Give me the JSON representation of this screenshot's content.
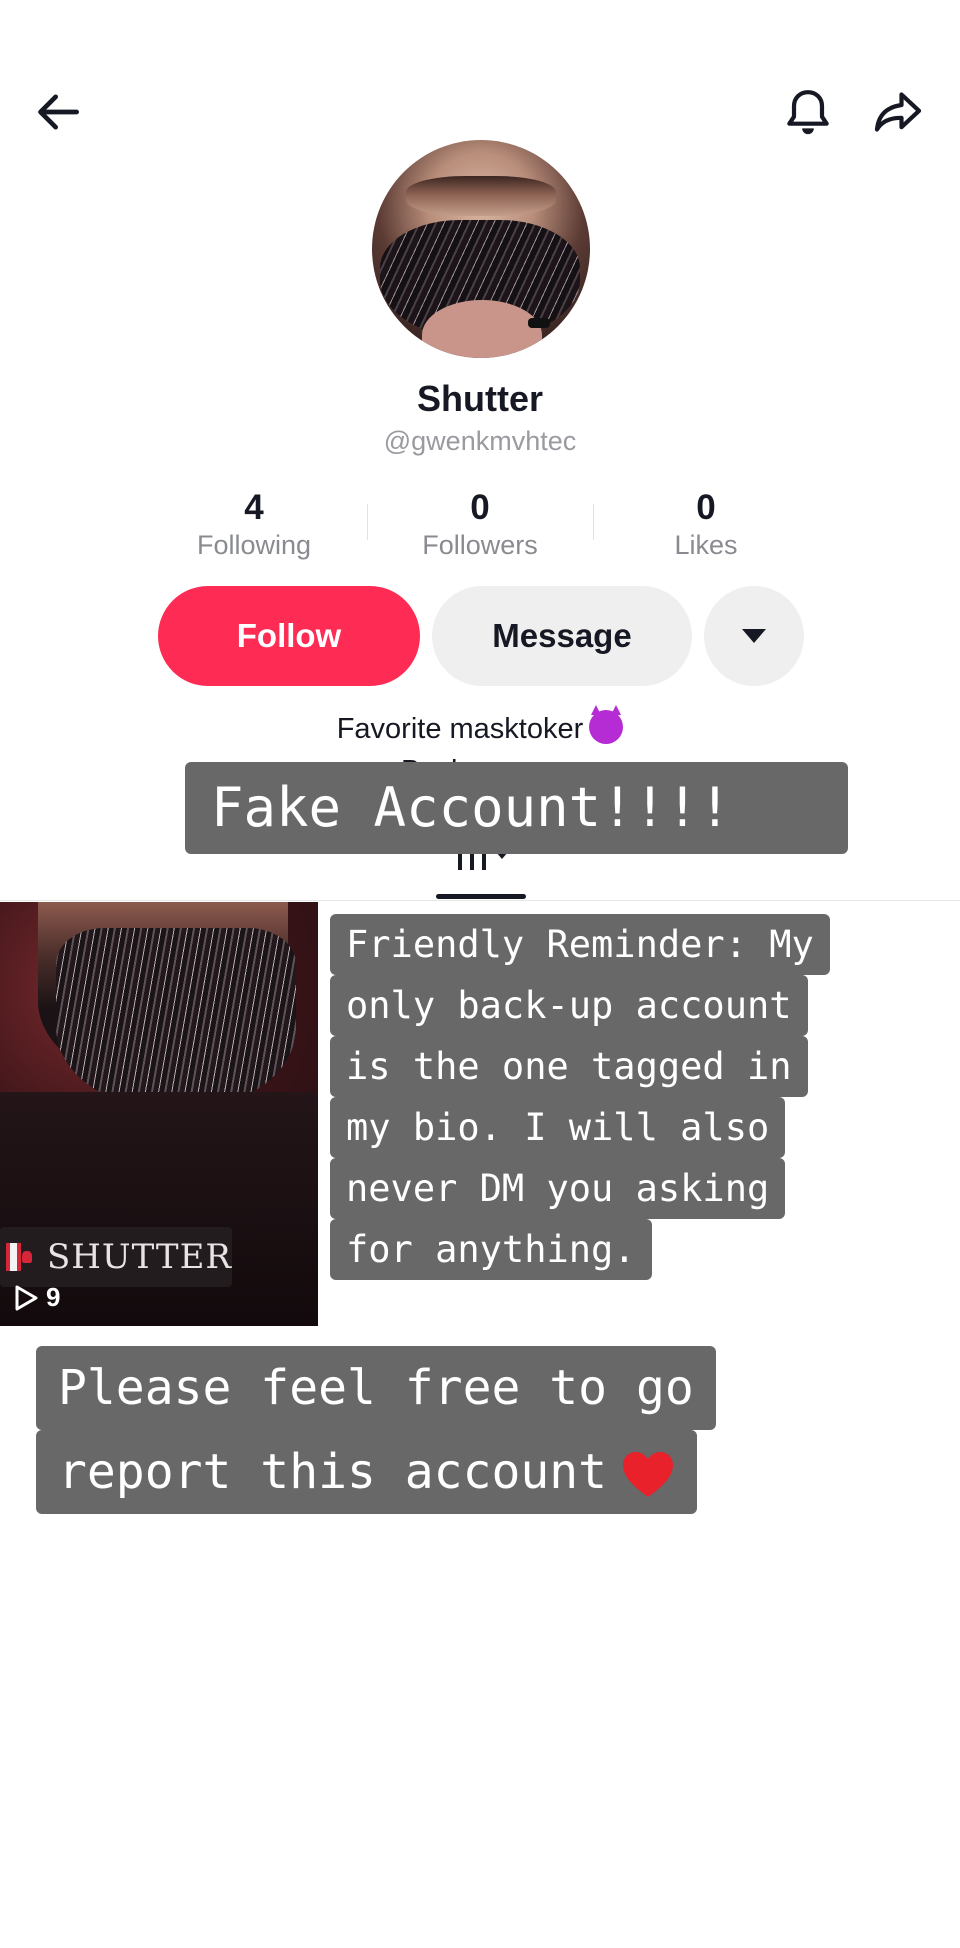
{
  "header": {
    "back_icon": "arrow-left-icon",
    "bell_icon": "bell-icon",
    "share_icon": "share-arrow-icon"
  },
  "profile": {
    "display_name": "Shutter",
    "username": "@gwenkmvhtec",
    "stats": {
      "following": {
        "value": "4",
        "label": "Following"
      },
      "followers": {
        "value": "0",
        "label": "Followers"
      },
      "likes": {
        "value": "0",
        "label": "Likes"
      }
    },
    "buttons": {
      "follow": "Follow",
      "message": "Message",
      "more_icon": "caret-down-icon"
    },
    "bio": {
      "line1": "Favorite masktoker",
      "emoji": "smiling-devil-emoji",
      "line2": "Back up acc"
    }
  },
  "tabs": {
    "active_icon": "grid-videos-icon"
  },
  "videos": [
    {
      "play_count": "9",
      "overlay_text": "SHUTTER"
    }
  ],
  "captions": {
    "fake_account": "Fake Account!!!!",
    "reminder_lines": [
      "Friendly Reminder: My",
      "only back-up account",
      "is the one tagged in",
      "my bio. I will also",
      "never DM you asking",
      "for anything."
    ],
    "report_lines": [
      "Please feel free to go",
      "report this account"
    ]
  },
  "colors": {
    "follow_button": "#fe2c55",
    "secondary_button": "#efefef",
    "caption_background": "#686868",
    "text_primary": "#161823",
    "text_secondary": "#8a8b91",
    "heart": "#e8212b"
  }
}
